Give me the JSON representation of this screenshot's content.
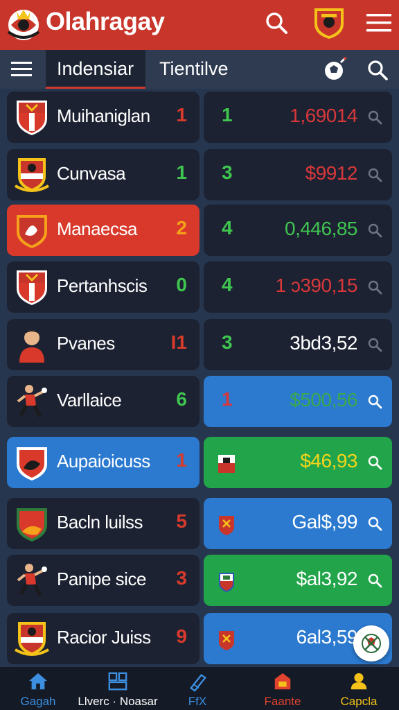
{
  "app": {
    "title": "Olahragay"
  },
  "tabs": [
    {
      "label": "Indensiar",
      "active": true
    },
    {
      "label": "Tientilve",
      "active": false
    }
  ],
  "rows": [
    {
      "team": "Muihaniglan",
      "left_value": "1",
      "left_color": "#d83a2c",
      "right_value": "1",
      "right_value_color": "#3fc64f",
      "price": "1,69014",
      "price_color": "#d8383a",
      "row_style": "dark",
      "right_style": "dark"
    },
    {
      "team": "Cunvasa",
      "left_value": "1",
      "left_color": "#3fc64f",
      "right_value": "3",
      "right_value_color": "#3fc64f",
      "price": "$9912",
      "price_color": "#d8383a",
      "row_style": "dark",
      "right_style": "dark"
    },
    {
      "team": "Manaecsa",
      "left_value": "2",
      "left_color": "#f4a21a",
      "right_value": "4",
      "right_value_color": "#3fc64f",
      "price": "0,446,85",
      "price_color": "#3fc64f",
      "row_style": "red",
      "right_style": "dark"
    },
    {
      "team": "Pertanhscis",
      "left_value": "0",
      "left_color": "#3fc64f",
      "right_value": "4",
      "right_value_color": "#3fc64f",
      "price": "1 ɔ390,15",
      "price_color": "#d8383a",
      "row_style": "dark",
      "right_style": "dark"
    },
    {
      "team": "Pvanes",
      "left_value": "I1",
      "left_color": "#d83a2c",
      "right_value": "3",
      "right_value_color": "#3fc64f",
      "price": "3bd3,52",
      "price_color": "#ffffff",
      "row_style": "dark",
      "right_style": "dark"
    },
    {
      "team": "Varllaice",
      "left_value": "6",
      "left_color": "#3fc64f",
      "right_value": "1",
      "right_value_color": "#d8383a",
      "price": "$500,56",
      "price_color": "#3aa84e",
      "row_style": "dark",
      "right_style": "blue"
    },
    {
      "team": "Aupaioicuss",
      "left_value": "1",
      "left_color": "#d83a2c",
      "right_value": "",
      "right_value_color": "#ffffff",
      "price": "$46,93",
      "price_color": "#f5d51c",
      "row_style": "blue",
      "right_style": "green"
    },
    {
      "team": "Bacln luilss",
      "left_value": "5",
      "left_color": "#d83a2c",
      "right_value": "",
      "right_value_color": "#ffffff",
      "price": "Gal$,99",
      "price_color": "#ffffff",
      "row_style": "dark",
      "right_style": "blue"
    },
    {
      "team": "Panipe sice",
      "left_value": "3",
      "left_color": "#d83a2c",
      "right_value": "",
      "right_value_color": "#ffffff",
      "price": "$al3,92",
      "price_color": "#ffffff",
      "row_style": "dark",
      "right_style": "green"
    },
    {
      "team": "Racior Juiss",
      "left_value": "9",
      "left_color": "#d83a2c",
      "right_value": "",
      "right_value_color": "#ffffff",
      "price": "6al3,59",
      "price_color": "#ffffff",
      "row_style": "dark",
      "right_style": "blue"
    }
  ],
  "bottom_nav": [
    {
      "label": "Gagah",
      "color": "#3d8fe0",
      "icon": "home-icon"
    },
    {
      "label": "Llverc · Noasar",
      "color": "#ffffff",
      "icon": "grid-icon"
    },
    {
      "label": "FfX",
      "color": "#3d8fe0",
      "icon": "pen-icon"
    },
    {
      "label": "Faante",
      "color": "#e2432e",
      "icon": "shop-icon"
    },
    {
      "label": "Capcla",
      "color": "#f5c21a",
      "icon": "user-icon"
    }
  ],
  "colors": {
    "accent": "#c8352b",
    "background": "#27364f"
  }
}
